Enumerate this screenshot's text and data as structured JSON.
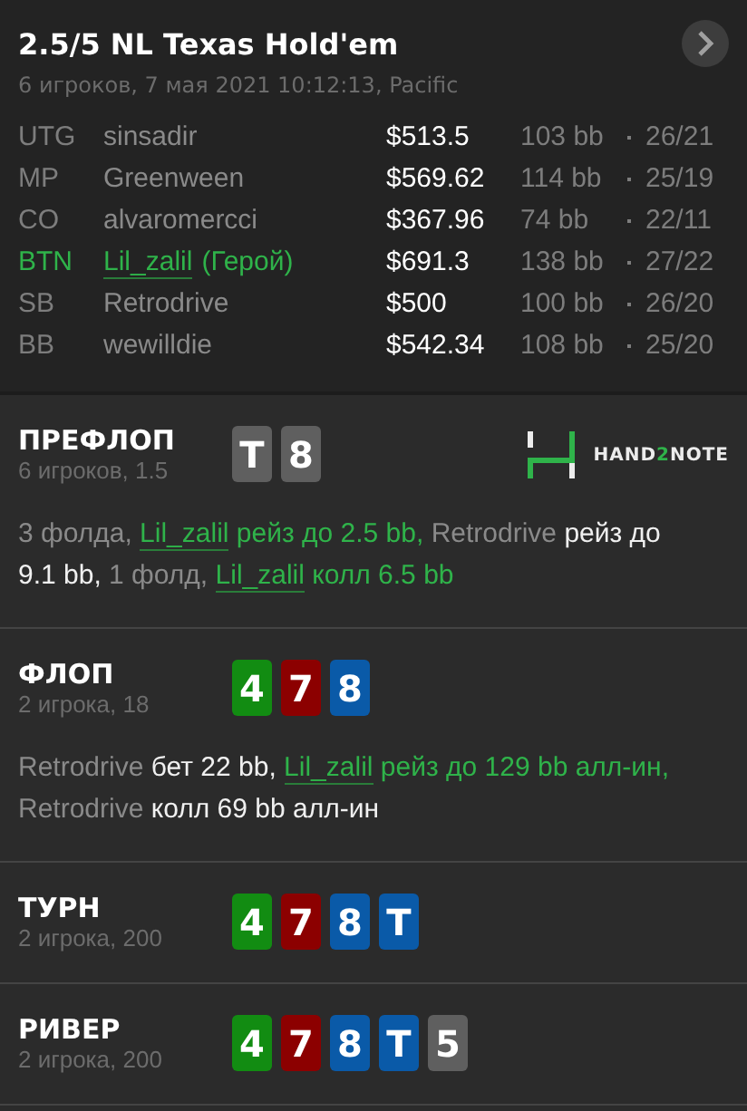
{
  "header": {
    "title": "2.5/5 NL Texas Hold'em",
    "subtitle": "6 игроков, 7 мая 2021 10:12:13, Pacific"
  },
  "players": [
    {
      "position": "UTG",
      "name": "sinsadir",
      "hero": false,
      "stack": "$513.5",
      "bb": "103 bb",
      "ratio": "26/21"
    },
    {
      "position": "MP",
      "name": "Greenween",
      "hero": false,
      "stack": "$569.62",
      "bb": "114 bb",
      "ratio": "25/19"
    },
    {
      "position": "CO",
      "name": "alvaromercci",
      "hero": false,
      "stack": "$367.96",
      "bb": "74 bb",
      "ratio": "22/11"
    },
    {
      "position": "BTN",
      "name": "Lil_zalil",
      "hero": true,
      "hero_label": "(Герой)",
      "stack": "$691.3",
      "bb": "138 bb",
      "ratio": "27/22"
    },
    {
      "position": "SB",
      "name": "Retrodrive",
      "hero": false,
      "stack": "$500",
      "bb": "100 bb",
      "ratio": "26/20"
    },
    {
      "position": "BB",
      "name": "wewilldie",
      "hero": false,
      "stack": "$542.34",
      "bb": "108 bb",
      "ratio": "25/20"
    }
  ],
  "streets": [
    {
      "name": "ПРЕФЛОП",
      "info": "6 игроков, 1.5",
      "cards": [
        {
          "rank": "T",
          "color": "#5f5f5f"
        },
        {
          "rank": "8",
          "color": "#5f5f5f"
        }
      ],
      "logo": [
        {
          "text": "HAND",
          "kind": "plain"
        },
        {
          "text": "2",
          "kind": "accent"
        },
        {
          "text": "NOTE",
          "kind": "plain"
        }
      ],
      "actions": [
        {
          "text": "3 фолда, ",
          "kind": "muted"
        },
        {
          "text": "Lil_zalil",
          "kind": "hero_name"
        },
        {
          "text": " рейз до 2.5 bb, ",
          "kind": "hero"
        },
        {
          "text": "Retrodrive ",
          "kind": "muted"
        },
        {
          "text": "рейз до 9.1 bb, ",
          "kind": "action"
        },
        {
          "text": "1 фолд, ",
          "kind": "muted"
        },
        {
          "text": "Lil_zalil",
          "kind": "hero_name"
        },
        {
          "text": " колл 6.5 bb",
          "kind": "hero"
        }
      ]
    },
    {
      "name": "ФЛОП",
      "info": "2 игрока, 18",
      "cards": [
        {
          "rank": "4",
          "color": "#128c12"
        },
        {
          "rank": "7",
          "color": "#8c0000"
        },
        {
          "rank": "8",
          "color": "#0a5aa8"
        }
      ],
      "actions": [
        {
          "text": "Retrodrive ",
          "kind": "muted"
        },
        {
          "text": "бет 22 bb, ",
          "kind": "action"
        },
        {
          "text": "Lil_zalil",
          "kind": "hero_name"
        },
        {
          "text": " рейз до 129 bb алл-ин, ",
          "kind": "hero"
        },
        {
          "text": "Retrodrive ",
          "kind": "muted"
        },
        {
          "text": "колл 69 bb алл-ин",
          "kind": "action"
        }
      ]
    },
    {
      "name": "ТУРН",
      "info": "2 игрока, 200",
      "cards": [
        {
          "rank": "4",
          "color": "#128c12"
        },
        {
          "rank": "7",
          "color": "#8c0000"
        },
        {
          "rank": "8",
          "color": "#0a5aa8"
        },
        {
          "rank": "T",
          "color": "#0a5aa8"
        }
      ]
    },
    {
      "name": "РИВЕР",
      "info": "2 игрока, 200",
      "cards": [
        {
          "rank": "4",
          "color": "#128c12"
        },
        {
          "rank": "7",
          "color": "#8c0000"
        },
        {
          "rank": "8",
          "color": "#0a5aa8"
        },
        {
          "rank": "T",
          "color": "#0a5aa8"
        },
        {
          "rank": "5",
          "color": "#5f5f5f"
        }
      ]
    }
  ]
}
